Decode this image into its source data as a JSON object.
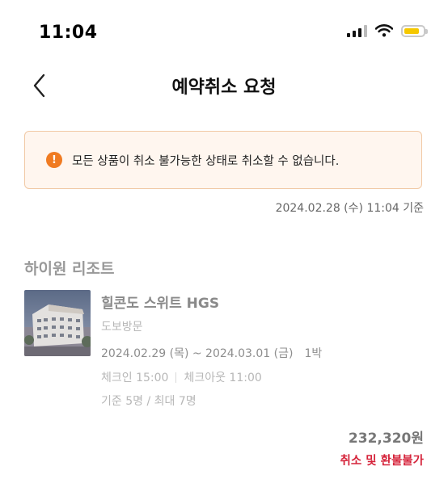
{
  "status_bar": {
    "time": "11:04",
    "battery_color": "#f5c800"
  },
  "header": {
    "title": "예약취소 요청",
    "back_icon": "chevron-left-icon"
  },
  "notice": {
    "icon": "info-icon",
    "icon_glyph": "!",
    "text": "모든 상품이 취소 불가능한 상태로 취소할 수 없습니다.",
    "accent": "#f07b22"
  },
  "timestamp": "2024.02.28 (수) 11:04 기준",
  "booking": {
    "property_name": "하이원 리조트",
    "room_name": "힐콘도 스위트 HGS",
    "room_type": "도보방문",
    "dates": "2024.02.29 (목) ~ 2024.03.01 (금)",
    "nights": "1박",
    "check_in": "체크인 15:00",
    "check_out": "체크아웃 11:00",
    "capacity": "기준 5명 / 최대 7명",
    "price": "232,320원",
    "refund_status": "취소 및 환불불가",
    "refund_color": "#d5233a"
  }
}
